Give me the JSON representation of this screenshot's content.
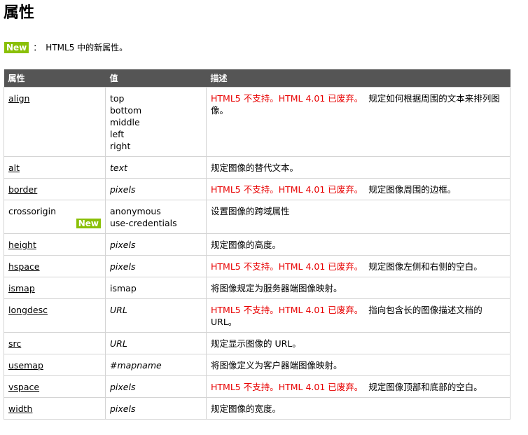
{
  "page_title": "属性",
  "legend": {
    "badge": "New",
    "separator": "：",
    "text": "HTML5 中的新属性。"
  },
  "colors": {
    "badge_bg": "#8ac007",
    "header_bg": "#555555",
    "deprecated": "#e80000"
  },
  "table": {
    "headers": [
      "属性",
      "值",
      "描述"
    ],
    "rows": [
      {
        "attr": "align",
        "link": true,
        "values": [
          "top",
          "bottom",
          "middle",
          "left",
          "right"
        ],
        "italic": false,
        "deprecated": "HTML5 不支持。HTML 4.01 已废弃。",
        "desc": "规定如何根据周围的文本来排列图像。"
      },
      {
        "attr": "alt",
        "link": true,
        "values": [
          "text"
        ],
        "italic": true,
        "deprecated": "",
        "desc": "规定图像的替代文本。"
      },
      {
        "attr": "border",
        "link": true,
        "values": [
          "pixels"
        ],
        "italic": true,
        "deprecated": "HTML5 不支持。HTML 4.01 已废弃。",
        "desc": "规定图像周围的边框。"
      },
      {
        "attr": "crossorigin",
        "link": false,
        "badge": "New",
        "values": [
          "anonymous",
          "use-credentials"
        ],
        "italic": false,
        "deprecated": "",
        "desc": "设置图像的跨域属性"
      },
      {
        "attr": "height",
        "link": true,
        "values": [
          "pixels"
        ],
        "italic": true,
        "deprecated": "",
        "desc": "规定图像的高度。"
      },
      {
        "attr": "hspace",
        "link": true,
        "values": [
          "pixels"
        ],
        "italic": true,
        "deprecated": "HTML5 不支持。HTML 4.01 已废弃。",
        "desc": "规定图像左侧和右侧的空白。"
      },
      {
        "attr": "ismap",
        "link": true,
        "values": [
          "ismap"
        ],
        "italic": false,
        "deprecated": "",
        "desc": "将图像规定为服务器端图像映射。"
      },
      {
        "attr": "longdesc",
        "link": true,
        "values": [
          "URL"
        ],
        "italic": true,
        "deprecated": "HTML5 不支持。HTML 4.01 已废弃。",
        "desc": "指向包含长的图像描述文档的 URL。"
      },
      {
        "attr": "src",
        "link": true,
        "values": [
          "URL"
        ],
        "italic": true,
        "deprecated": "",
        "desc": "规定显示图像的 URL。"
      },
      {
        "attr": "usemap",
        "link": true,
        "values": [
          "#mapname"
        ],
        "italic": true,
        "deprecated": "",
        "desc": "将图像定义为客户器端图像映射。"
      },
      {
        "attr": "vspace",
        "link": true,
        "values": [
          "pixels"
        ],
        "italic": true,
        "deprecated": "HTML5 不支持。HTML 4.01 已废弃。",
        "desc": "规定图像顶部和底部的空白。"
      },
      {
        "attr": "width",
        "link": true,
        "values": [
          "pixels"
        ],
        "italic": true,
        "deprecated": "",
        "desc": "规定图像的宽度。"
      }
    ]
  }
}
